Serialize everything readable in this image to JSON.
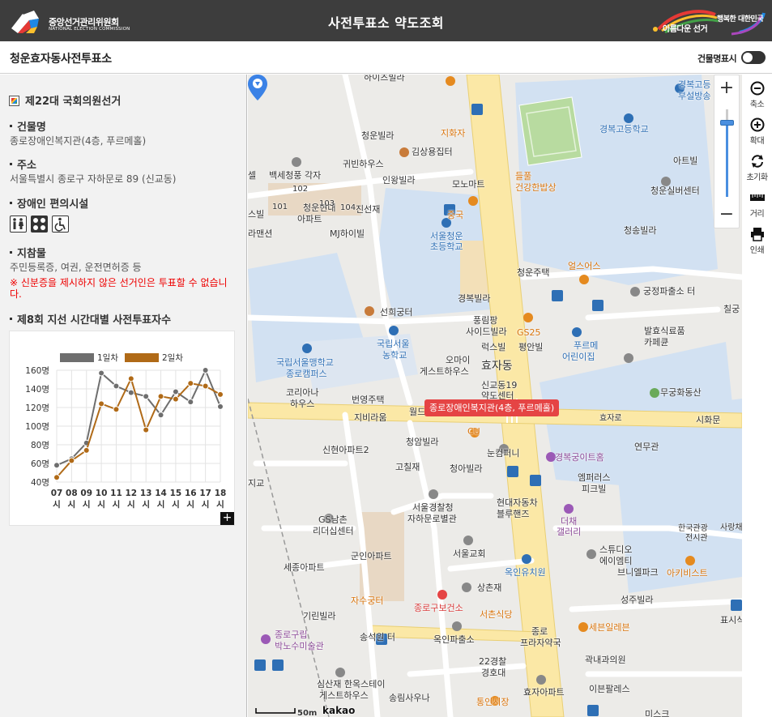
{
  "header": {
    "org_name": "중앙선거관리위원회",
    "org_name_en": "NATIONAL ELECTION COMMISSION",
    "title": "사전투표소 약도조회",
    "slogan_left": "아름다운 선거",
    "slogan_right": "행복한 대한민국"
  },
  "subheader": {
    "place_name": "청운효자동사전투표소",
    "building_name_toggle_label": "건물명표시"
  },
  "panel": {
    "election_title": "제22대 국회의원선거",
    "building_heading": "건물명",
    "building_value": "종로장애인복지관(4층, 푸르메홀)",
    "address_heading": "주소",
    "address_value": "서울특별시 종로구 자하문로 89 (신교동)",
    "facilities_heading": "장애인 편의시설",
    "facility_icons": [
      "accessible-restroom-icon",
      "braille-block-icon",
      "wheelchair-icon"
    ],
    "items_heading": "지참물",
    "items_value": "주민등록증, 여권, 운전면허증 등",
    "notice": "※ 신분증을 제시하지 않은 선거인은 투표할 수 없습니다.",
    "chart_heading": "제8회 지선 시간대별 사전투표자수"
  },
  "chart_data": {
    "type": "line",
    "title": "",
    "xlabel": "",
    "ylabel": "",
    "categories": [
      "07시",
      "08시",
      "09시",
      "10시",
      "11시",
      "12시",
      "13시",
      "14시",
      "15시",
      "16시",
      "17시",
      "18시"
    ],
    "category_numbers": [
      "07",
      "08",
      "09",
      "10",
      "11",
      "12",
      "13",
      "14",
      "15",
      "16",
      "17",
      "18"
    ],
    "category_suffix": "시",
    "y_ticks": [
      "40명",
      "60명",
      "80명",
      "100명",
      "120명",
      "140명",
      "160명"
    ],
    "ylim": [
      40,
      160
    ],
    "grid": true,
    "legend_position": "top",
    "series": [
      {
        "name": "1일차",
        "color": "#6e6e6e",
        "values": [
          58,
          65,
          82,
          157,
          143,
          136,
          132,
          112,
          137,
          126,
          160,
          121
        ]
      },
      {
        "name": "2일차",
        "color": "#b06a17",
        "values": [
          45,
          63,
          74,
          124,
          118,
          151,
          96,
          132,
          129,
          146,
          143,
          134
        ]
      }
    ]
  },
  "map": {
    "selected_place_label": "종로장애인복지관(4층, 푸르메홀)",
    "scale_label": "50m",
    "provider": "kakao",
    "labels": [
      {
        "text": "하이츠빌라",
        "cls": ""
      },
      {
        "text": "지화자",
        "cls": "orange"
      },
      {
        "text": "청운빌라",
        "cls": ""
      },
      {
        "text": "김상용집터",
        "cls": ""
      },
      {
        "text": "귀빈하우스",
        "cls": ""
      },
      {
        "text": "인왕빌라",
        "cls": ""
      },
      {
        "text": "모노마트",
        "cls": ""
      },
      {
        "text": "백세청풍 각자",
        "cls": ""
      },
      {
        "text": "청운현대",
        "cls": ""
      },
      {
        "text": "아파트",
        "cls": ""
      },
      {
        "text": "진선재",
        "cls": ""
      },
      {
        "text": "중국",
        "cls": "orange"
      },
      {
        "text": "MJ하이빌",
        "cls": ""
      },
      {
        "text": "서울청운",
        "cls": "blue"
      },
      {
        "text": "초등학교",
        "cls": "blue"
      },
      {
        "text": "들풀",
        "cls": "orange"
      },
      {
        "text": "건강한밥상",
        "cls": "orange"
      },
      {
        "text": "경복고등학교",
        "cls": "blue"
      },
      {
        "text": "경복고등",
        "cls": "blue"
      },
      {
        "text": "부설방송",
        "cls": "blue"
      },
      {
        "text": "아트빌",
        "cls": ""
      },
      {
        "text": "청운실버센터",
        "cls": ""
      },
      {
        "text": "청송빌라",
        "cls": ""
      },
      {
        "text": "청운주택",
        "cls": ""
      },
      {
        "text": "얼스어스",
        "cls": "orange"
      },
      {
        "text": "궁정파출소 터",
        "cls": ""
      },
      {
        "text": "경복빌라",
        "cls": ""
      },
      {
        "text": "선희궁터",
        "cls": ""
      },
      {
        "text": "풍림팡",
        "cls": ""
      },
      {
        "text": "사이드빌라",
        "cls": ""
      },
      {
        "text": "GS25",
        "cls": "orange"
      },
      {
        "text": "국립서울",
        "cls": "blue"
      },
      {
        "text": "농학교",
        "cls": "blue"
      },
      {
        "text": "럭스빌",
        "cls": ""
      },
      {
        "text": "평안빌",
        "cls": ""
      },
      {
        "text": "푸르메",
        "cls": "blue"
      },
      {
        "text": "어린이집",
        "cls": "blue"
      },
      {
        "text": "발효식료품",
        "cls": ""
      },
      {
        "text": "카페큔",
        "cls": ""
      },
      {
        "text": "국립서울맹학교",
        "cls": "blue"
      },
      {
        "text": "종로캠퍼스",
        "cls": "blue"
      },
      {
        "text": "오마이",
        "cls": ""
      },
      {
        "text": "게스트하우스",
        "cls": ""
      },
      {
        "text": "효자동",
        "cls": ""
      },
      {
        "text": "신교동19",
        "cls": ""
      },
      {
        "text": "약도센터",
        "cls": ""
      },
      {
        "text": "코리아나",
        "cls": ""
      },
      {
        "text": "하우스",
        "cls": ""
      },
      {
        "text": "번영주택",
        "cls": ""
      },
      {
        "text": "무궁화동산",
        "cls": ""
      },
      {
        "text": "효자로",
        "cls": ""
      },
      {
        "text": "시화문",
        "cls": ""
      },
      {
        "text": "지비라움",
        "cls": ""
      },
      {
        "text": "월드",
        "cls": ""
      },
      {
        "text": "CU",
        "cls": "orange"
      },
      {
        "text": "청암빌라",
        "cls": ""
      },
      {
        "text": "눈컴퍼니",
        "cls": ""
      },
      {
        "text": "신현아파트2",
        "cls": ""
      },
      {
        "text": "경복궁이트홈",
        "cls": "purple"
      },
      {
        "text": "연무관",
        "cls": ""
      },
      {
        "text": "고칠재",
        "cls": ""
      },
      {
        "text": "청아빌라",
        "cls": ""
      },
      {
        "text": "엠퍼러스",
        "cls": ""
      },
      {
        "text": "피크빌",
        "cls": ""
      },
      {
        "text": "서울경찰청",
        "cls": ""
      },
      {
        "text": "자하문로별관",
        "cls": ""
      },
      {
        "text": "현대자동차",
        "cls": ""
      },
      {
        "text": "블루핸즈",
        "cls": ""
      },
      {
        "text": "더채",
        "cls": "purple"
      },
      {
        "text": "갤러리",
        "cls": "purple"
      },
      {
        "text": "GS남촌",
        "cls": ""
      },
      {
        "text": "리더십센터",
        "cls": ""
      },
      {
        "text": "한국관광",
        "cls": ""
      },
      {
        "text": "전시관",
        "cls": ""
      },
      {
        "text": "사랑채",
        "cls": ""
      },
      {
        "text": "서울교회",
        "cls": ""
      },
      {
        "text": "스튜디오",
        "cls": ""
      },
      {
        "text": "에이엠티",
        "cls": ""
      },
      {
        "text": "군인아파트",
        "cls": ""
      },
      {
        "text": "세종아파트",
        "cls": ""
      },
      {
        "text": "옥인유치원",
        "cls": "blue"
      },
      {
        "text": "브니엘파크",
        "cls": ""
      },
      {
        "text": "아키비스트",
        "cls": "orange"
      },
      {
        "text": "상촌재",
        "cls": ""
      },
      {
        "text": "자수궁터",
        "cls": "orange"
      },
      {
        "text": "종로구보건소",
        "cls": "red"
      },
      {
        "text": "성주빌라",
        "cls": ""
      },
      {
        "text": "기린빌라",
        "cls": ""
      },
      {
        "text": "서촌식당",
        "cls": "orange"
      },
      {
        "text": "세븐일레븐",
        "cls": "orange"
      },
      {
        "text": "종로구립",
        "cls": "purple"
      },
      {
        "text": "박노수미술관",
        "cls": "purple"
      },
      {
        "text": "송석원 터",
        "cls": ""
      },
      {
        "text": "옥인파출소",
        "cls": ""
      },
      {
        "text": "종로",
        "cls": ""
      },
      {
        "text": "프라자약국",
        "cls": ""
      },
      {
        "text": "22경찰",
        "cls": ""
      },
      {
        "text": "경호대",
        "cls": ""
      },
      {
        "text": "곽내과의원",
        "cls": ""
      },
      {
        "text": "심산재 한옥스테이",
        "cls": ""
      },
      {
        "text": "게스트하우스",
        "cls": ""
      },
      {
        "text": "통인시장",
        "cls": "orange"
      },
      {
        "text": "효자아파트",
        "cls": ""
      },
      {
        "text": "이븐팔레스",
        "cls": ""
      },
      {
        "text": "송림사우나",
        "cls": ""
      },
      {
        "text": "표시식",
        "cls": ""
      },
      {
        "text": "칠궁",
        "cls": ""
      },
      {
        "text": "지교",
        "cls": ""
      },
      {
        "text": "101",
        "cls": "small"
      },
      {
        "text": "102",
        "cls": "small"
      },
      {
        "text": "103",
        "cls": "small"
      },
      {
        "text": "104",
        "cls": "small"
      },
      {
        "text": "스빌",
        "cls": ""
      },
      {
        "text": "셀",
        "cls": ""
      },
      {
        "text": "라맨션",
        "cls": ""
      },
      {
        "text": "미스크",
        "cls": ""
      }
    ]
  },
  "map_controls": {
    "zoom_in": "+",
    "zoom_out": "−",
    "tools": [
      {
        "key": "zoom-out",
        "label": "축소"
      },
      {
        "key": "zoom-in",
        "label": "확대"
      },
      {
        "key": "reset",
        "label": "초기화"
      },
      {
        "key": "distance",
        "label": "거리"
      },
      {
        "key": "print",
        "label": "인쇄"
      }
    ]
  }
}
